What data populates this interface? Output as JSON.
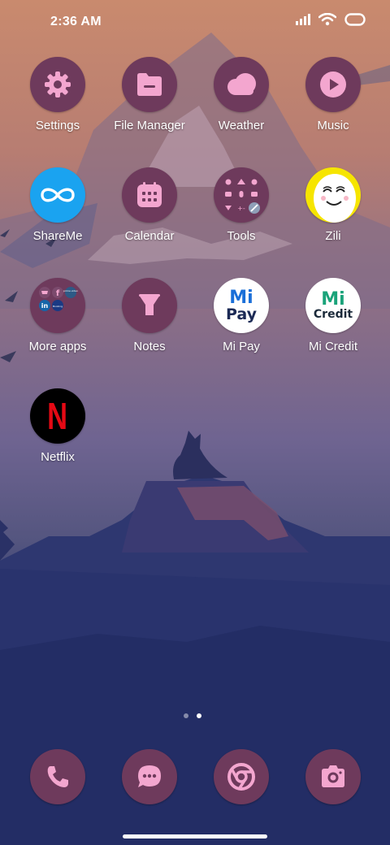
{
  "status_bar": {
    "time": "2:36 AM",
    "icons": [
      "signal-icon",
      "wifi-icon",
      "battery-icon"
    ]
  },
  "apps": [
    {
      "label": "Settings",
      "icon": "gear-icon"
    },
    {
      "label": "File Manager",
      "icon": "folder-icon"
    },
    {
      "label": "Weather",
      "icon": "cloud-icon"
    },
    {
      "label": "Music",
      "icon": "play-icon"
    },
    {
      "label": "ShareMe",
      "icon": "infinity-icon"
    },
    {
      "label": "Calendar",
      "icon": "calendar-icon"
    },
    {
      "label": "Tools",
      "icon": "tools-folder-icon"
    },
    {
      "label": "Zili",
      "icon": "smiley-face-icon"
    },
    {
      "label": "More apps",
      "icon": "apps-folder-icon"
    },
    {
      "label": "Notes",
      "icon": "funnel-icon"
    },
    {
      "label": "Mi Pay",
      "icon": "mi-pay-logo",
      "logo_top": "Mi",
      "logo_bottom": "Pay"
    },
    {
      "label": "Mi Credit",
      "icon": "mi-credit-logo",
      "logo_top": "Mi",
      "logo_bottom": "Credit"
    },
    {
      "label": "Netflix",
      "icon": "netflix-logo",
      "logo_text": "N"
    }
  ],
  "more_apps_folder": {
    "mini_icons": [
      "shopping-cart-icon",
      "facebook-icon",
      "amazon-prime-icon",
      "linkedin-icon",
      "booking-icon"
    ],
    "mini_labels": {
      "facebook": "f",
      "linkedin": "in",
      "amazon": "prime video",
      "booking": "Booking"
    }
  },
  "dock": [
    {
      "name": "phone",
      "icon": "phone-icon"
    },
    {
      "name": "messages",
      "icon": "chat-bubble-icon"
    },
    {
      "name": "browser",
      "icon": "chrome-icon"
    },
    {
      "name": "camera",
      "icon": "camera-icon"
    }
  ],
  "page_indicator": {
    "pages": 2,
    "current": 2
  },
  "colors": {
    "icon_bg": "#6e3a5c",
    "icon_glyph": "#f3a6cf",
    "sky_top": "#c98a6e",
    "night_bottom": "#1e2a57",
    "shareme_blue": "#1aa3f0",
    "zili_yellow": "#f6e500",
    "mi_green": "#1aa37a",
    "mi_blue": "#1a6fd8",
    "netflix_red": "#e50914"
  }
}
